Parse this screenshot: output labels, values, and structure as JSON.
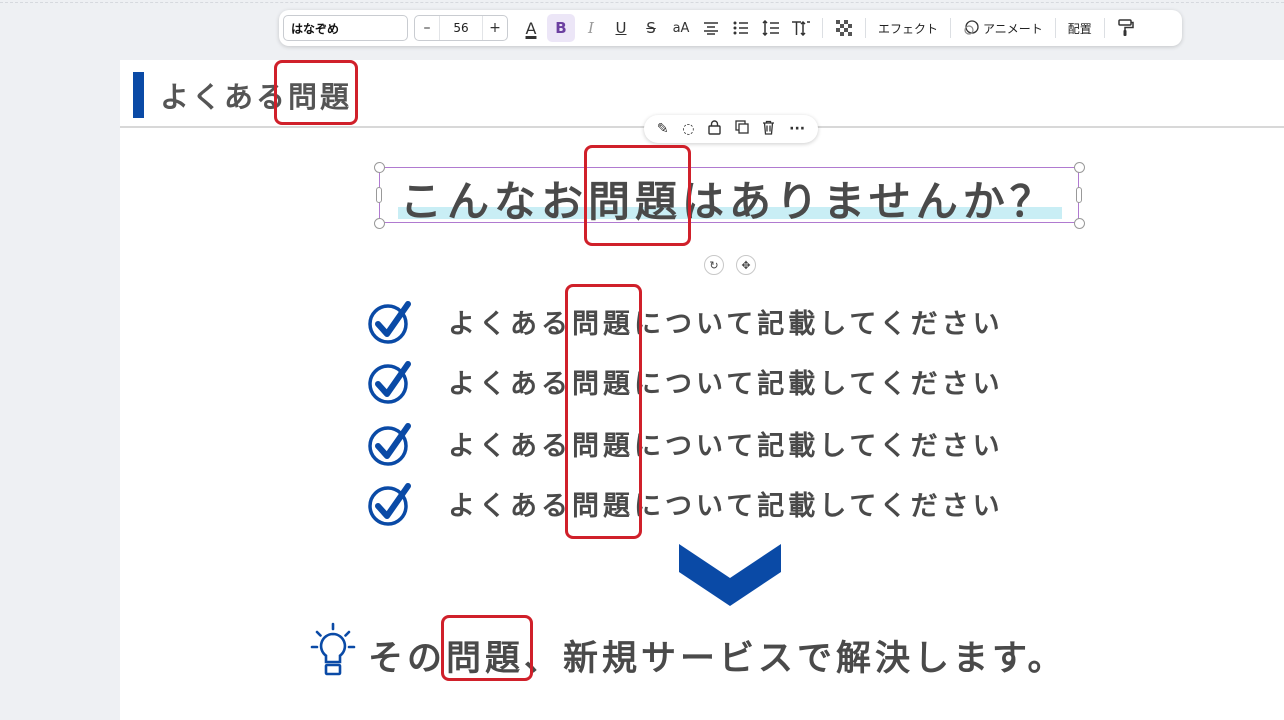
{
  "toolbar": {
    "font_name": "はなぞめ",
    "size_minus": "–",
    "font_size": "56",
    "size_plus": "+",
    "text_color_glyph": "A",
    "bold_glyph": "B",
    "italic_glyph": "I",
    "underline_glyph": "U",
    "strike_glyph": "S",
    "case_glyph": "aA",
    "effects_label": "エフェクト",
    "animate_label": "アニメート",
    "position_label": "配置"
  },
  "slide": {
    "header_title": "よくある問題",
    "main_title": "こんなお問題はありませんか？",
    "items": [
      "よくある問題について記載してください",
      "よくある問題について記載してください",
      "よくある問題について記載してください",
      "よくある問題について記載してください"
    ],
    "bottom_text": "その問題、新規サービスで解決します。"
  },
  "colors": {
    "accent_blue": "#0a4aa6",
    "annotation_red": "#d0202a",
    "text_gray": "#4a4a4a",
    "highlight_cyan": "#c9eef5",
    "selection_purple": "#b07ad0"
  }
}
